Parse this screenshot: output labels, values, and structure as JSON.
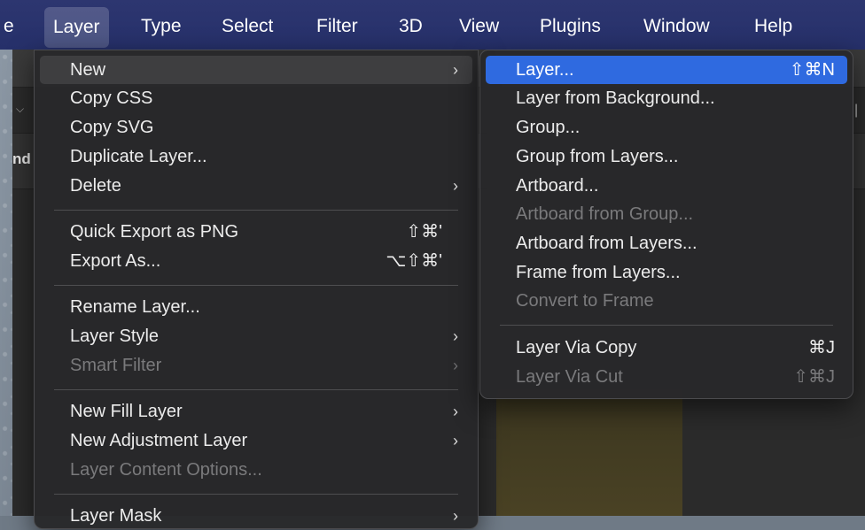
{
  "menubar": {
    "items": [
      "e",
      "Layer",
      "Type",
      "Select",
      "Filter",
      "3D",
      "View",
      "Plugins",
      "Window",
      "Help"
    ]
  },
  "app": {
    "panel_label": "nd"
  },
  "layer_menu": {
    "items": [
      {
        "label": "New",
        "shortcut": "",
        "arrow": true,
        "disabled": false
      },
      {
        "label": "Copy CSS",
        "shortcut": "",
        "arrow": false,
        "disabled": false
      },
      {
        "label": "Copy SVG",
        "shortcut": "",
        "arrow": false,
        "disabled": false
      },
      {
        "label": "Duplicate Layer...",
        "shortcut": "",
        "arrow": false,
        "disabled": false
      },
      {
        "label": "Delete",
        "shortcut": "",
        "arrow": true,
        "disabled": false
      },
      {
        "label": "Quick Export as PNG",
        "shortcut": "⇧⌘'",
        "arrow": false,
        "disabled": false
      },
      {
        "label": "Export As...",
        "shortcut": "⌥⇧⌘'",
        "arrow": false,
        "disabled": false
      },
      {
        "label": "Rename Layer...",
        "shortcut": "",
        "arrow": false,
        "disabled": false
      },
      {
        "label": "Layer Style",
        "shortcut": "",
        "arrow": true,
        "disabled": false
      },
      {
        "label": "Smart Filter",
        "shortcut": "",
        "arrow": true,
        "disabled": true
      },
      {
        "label": "New Fill Layer",
        "shortcut": "",
        "arrow": true,
        "disabled": false
      },
      {
        "label": "New Adjustment Layer",
        "shortcut": "",
        "arrow": true,
        "disabled": false
      },
      {
        "label": "Layer Content Options...",
        "shortcut": "",
        "arrow": false,
        "disabled": true
      },
      {
        "label": "Layer Mask",
        "shortcut": "",
        "arrow": true,
        "disabled": false
      }
    ]
  },
  "new_submenu": {
    "items": [
      {
        "label": "Layer...",
        "shortcut": "⇧⌘N",
        "disabled": false
      },
      {
        "label": "Layer from Background...",
        "shortcut": "",
        "disabled": false
      },
      {
        "label": "Group...",
        "shortcut": "",
        "disabled": false
      },
      {
        "label": "Group from Layers...",
        "shortcut": "",
        "disabled": false
      },
      {
        "label": "Artboard...",
        "shortcut": "",
        "disabled": false
      },
      {
        "label": "Artboard from Group...",
        "shortcut": "",
        "disabled": true
      },
      {
        "label": "Artboard from Layers...",
        "shortcut": "",
        "disabled": false
      },
      {
        "label": "Frame from Layers...",
        "shortcut": "",
        "disabled": false
      },
      {
        "label": "Convert to Frame",
        "shortcut": "",
        "disabled": true
      },
      {
        "label": "Layer Via Copy",
        "shortcut": "⌘J",
        "disabled": false
      },
      {
        "label": "Layer Via Cut",
        "shortcut": "⇧⌘J",
        "disabled": true
      }
    ]
  },
  "colors": {
    "menubar": "#2b3470",
    "highlight": "#2f6ae0",
    "menu_bg": "#28282a"
  }
}
